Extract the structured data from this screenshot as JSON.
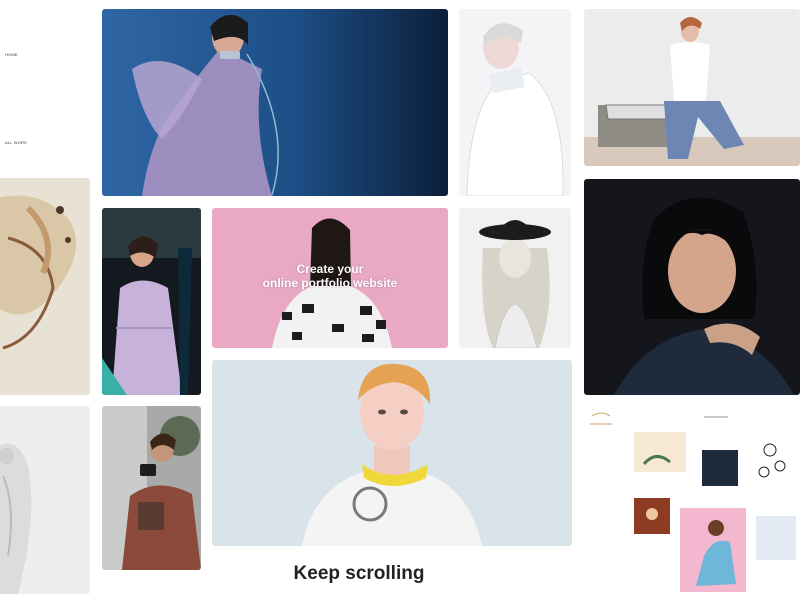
{
  "sidebar": {
    "items": [
      {
        "label": "HOME"
      },
      {
        "label": "ALL WORK"
      }
    ]
  },
  "hero": {
    "title_line1": "Create your",
    "title_line2": "online portfolio website"
  },
  "gallery": {
    "images": [
      {
        "name": "woman-with-telephone-blue-wall",
        "icon": "photo"
      },
      {
        "name": "woman-white-turtleneck",
        "icon": "photo"
      },
      {
        "name": "woman-sitting-on-bench",
        "icon": "photo"
      },
      {
        "name": "hands-abstract",
        "icon": "photo"
      },
      {
        "name": "woman-lilac-dress",
        "icon": "photo"
      },
      {
        "name": "woman-braids-pink-background",
        "icon": "photo"
      },
      {
        "name": "blonde-woman-black-hat",
        "icon": "photo"
      },
      {
        "name": "dark-portrait",
        "icon": "photo"
      },
      {
        "name": "white-fashion-figure",
        "icon": "photo"
      },
      {
        "name": "photographer-with-camera",
        "icon": "photo"
      },
      {
        "name": "redhead-yellow-collar",
        "icon": "photo"
      },
      {
        "name": "illustration-collection",
        "icon": "photo"
      }
    ]
  },
  "footer": {
    "keep_scrolling": "Keep scrolling"
  },
  "colors": {
    "hero_pink": "#e9a9c4",
    "blue_wall": "#1d4f86",
    "dark_portrait": "#14161b",
    "text_dark": "#222222"
  }
}
